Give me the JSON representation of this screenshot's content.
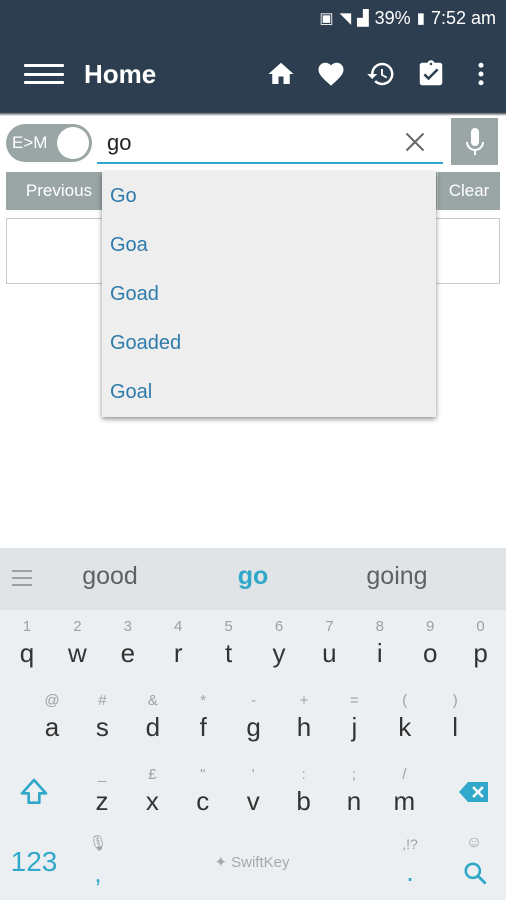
{
  "status_bar": {
    "battery": "39%",
    "time": "7:52 am"
  },
  "app_bar": {
    "title": "Home"
  },
  "search": {
    "toggle_label": "E>M",
    "query": "go"
  },
  "buttons": {
    "previous": "Previous",
    "clear": "Clear"
  },
  "suggestions": [
    "Go",
    "Goa",
    "Goad",
    "Goaded",
    "Goal"
  ],
  "keyboard": {
    "word_suggestions": [
      "good",
      "go",
      "going"
    ],
    "row1": [
      {
        "hint": "1",
        "key": "q"
      },
      {
        "hint": "2",
        "key": "w"
      },
      {
        "hint": "3",
        "key": "e"
      },
      {
        "hint": "4",
        "key": "r"
      },
      {
        "hint": "5",
        "key": "t"
      },
      {
        "hint": "6",
        "key": "y"
      },
      {
        "hint": "7",
        "key": "u"
      },
      {
        "hint": "8",
        "key": "i"
      },
      {
        "hint": "9",
        "key": "o"
      },
      {
        "hint": "0",
        "key": "p"
      }
    ],
    "row2": [
      {
        "hint": "@",
        "key": "a"
      },
      {
        "hint": "#",
        "key": "s"
      },
      {
        "hint": "&",
        "key": "d"
      },
      {
        "hint": "*",
        "key": "f"
      },
      {
        "hint": "-",
        "key": "g"
      },
      {
        "hint": "+",
        "key": "h"
      },
      {
        "hint": "=",
        "key": "j"
      },
      {
        "hint": "(",
        "key": "k"
      },
      {
        "hint": ")",
        "key": "l"
      }
    ],
    "row3": [
      {
        "hint": "_",
        "key": "z"
      },
      {
        "hint": "£",
        "key": "x"
      },
      {
        "hint": "\"",
        "key": "c"
      },
      {
        "hint": "'",
        "key": "v"
      },
      {
        "hint": ":",
        "key": "b"
      },
      {
        "hint": ";",
        "key": "n"
      },
      {
        "hint": "/",
        "key": "m"
      }
    ],
    "numbers_key": "123",
    "comma_key": ",",
    "period_key": ".",
    "period_hint": ",!?",
    "space_brand": "SwiftKey"
  }
}
